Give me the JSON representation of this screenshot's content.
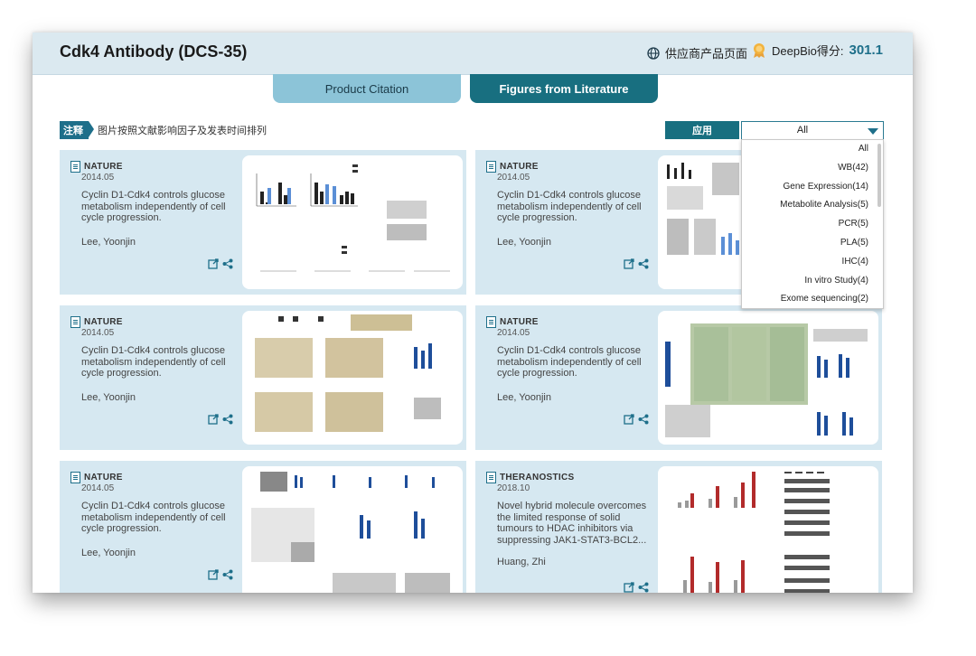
{
  "header": {
    "title": "Cdk4 Antibody (DCS-35)",
    "supplier_link": "供应商产品页面",
    "score_label": "DeepBio得分:",
    "score_value": "301.1"
  },
  "tabs": [
    {
      "label": "Product Citation",
      "active": false
    },
    {
      "label": "Figures from Literature",
      "active": true
    }
  ],
  "note": {
    "tag": "注释",
    "text": "图片按照文献影响因子及发表时间排列"
  },
  "filter": {
    "apply_label": "应用",
    "selected": "All",
    "options": [
      "All",
      "WB(42)",
      "Gene Expression(14)",
      "Metabolite Analysis(5)",
      "PCR(5)",
      "PLA(5)",
      "IHC(4)",
      "In vitro Study(4)",
      "Exome sequencing(2)"
    ]
  },
  "cards": [
    {
      "journal": "NATURE",
      "date": "2014.05",
      "title": "Cyclin D1-Cdk4 controls glucose metabolism independently of cell cycle progression.",
      "author": "Lee, Yoonjin"
    },
    {
      "journal": "NATURE",
      "date": "2014.05",
      "title": "Cyclin D1-Cdk4 controls glucose metabolism independently of cell cycle progression.",
      "author": "Lee, Yoonjin"
    },
    {
      "journal": "NATURE",
      "date": "2014.05",
      "title": "Cyclin D1-Cdk4 controls glucose metabolism independently of cell cycle progression.",
      "author": "Lee, Yoonjin"
    },
    {
      "journal": "NATURE",
      "date": "2014.05",
      "title": "Cyclin D1-Cdk4 controls glucose metabolism independently of cell cycle progression.",
      "author": "Lee, Yoonjin"
    },
    {
      "journal": "NATURE",
      "date": "2014.05",
      "title": "Cyclin D1-Cdk4 controls glucose metabolism independently of cell cycle progression.",
      "author": "Lee, Yoonjin"
    },
    {
      "journal": "THERANOSTICS",
      "date": "2018.10",
      "title": "Novel hybrid molecule overcomes the limited response of solid tumours to HDAC inhibitors via suppressing JAK1-STAT3-BCL2...",
      "author": "Huang, Zhi"
    }
  ],
  "colors": {
    "accent": "#1e6f8a",
    "header_bg": "#dbe9f0",
    "card_bg": "#d6e8f1",
    "tab_inactive": "#8cc4d8",
    "tab_active": "#186f80"
  }
}
